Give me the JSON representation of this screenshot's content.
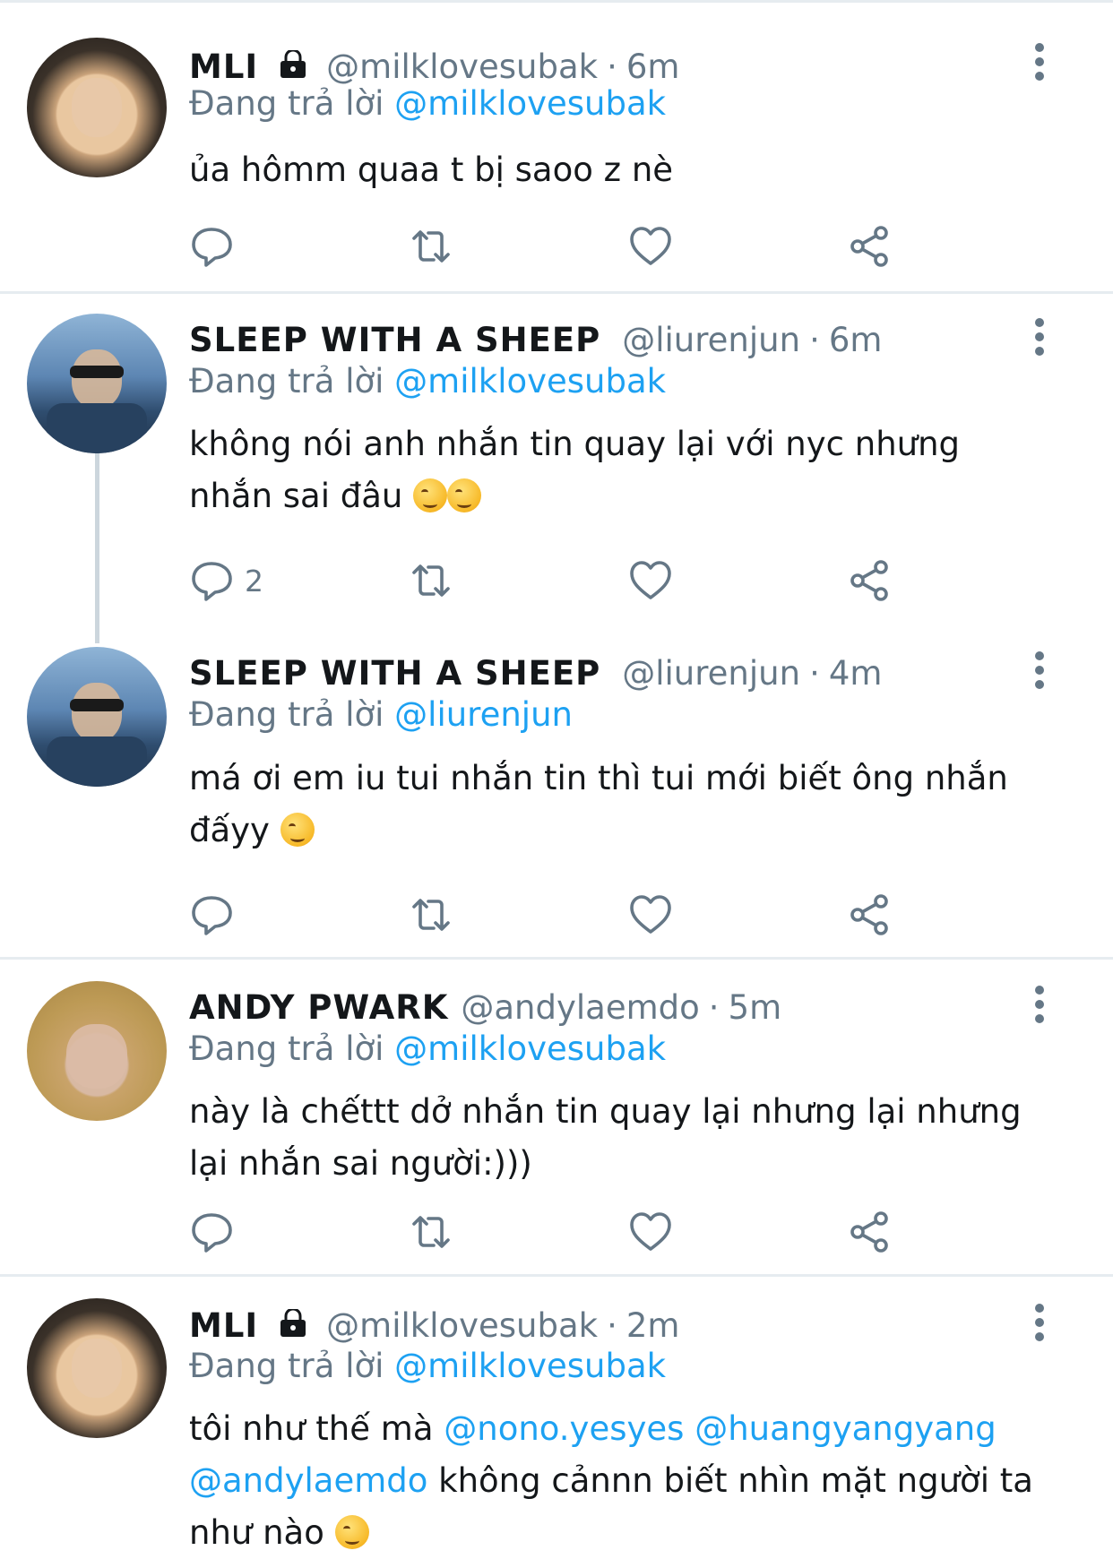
{
  "tweets": [
    {
      "name": "MLI",
      "protected": true,
      "handle": "@milklovesubak",
      "time": "6m",
      "reply_prefix": "Đang trả lời",
      "reply_to": "@milklovesubak",
      "text": "ủa hômm quaa t bị saoo z nè",
      "reply_count": ""
    },
    {
      "name": "SLEEP WITH A SHEEP",
      "protected": false,
      "handle": "@liurenjun",
      "time": "6m",
      "reply_prefix": "Đang trả lời",
      "reply_to": "@milklovesubak",
      "text": "không nói anh nhắn tin quay lại với nyc nhưng nhắn sai đâu",
      "reply_count": "2"
    },
    {
      "name": "SLEEP WITH A SHEEP",
      "protected": false,
      "handle": "@liurenjun",
      "time": "4m",
      "reply_prefix": "Đang trả lời",
      "reply_to": "@liurenjun",
      "text_line1": "má ơi em iu tui nhắn tin thì tui mới biết ông nhắn",
      "text_line2": "đấyy",
      "reply_count": ""
    },
    {
      "name": "ANDY PWARK",
      "protected": false,
      "handle": "@andylaemdo",
      "time": "5m",
      "reply_prefix": "Đang trả lời",
      "reply_to": "@milklovesubak",
      "text_line1": "này là chếttt dở nhắn tin quay lại nhưng lại nhưng",
      "text_line2": "lại nhắn sai người:)))",
      "reply_count": ""
    },
    {
      "name": "MLI",
      "protected": true,
      "handle": "@milklovesubak",
      "time": "2m",
      "reply_prefix": "Đang trả lời",
      "reply_to": "@milklovesubak",
      "text_part1": "tôi như thế mà",
      "mention1": "@nono.yesyes",
      "mention2": "@huangyangyang",
      "mention3": "@andylaemdo",
      "text_part2": "không cảnnn biết nhìn mặt người ta",
      "text_part3": "như nào",
      "reply_count": ""
    }
  ],
  "separator": "·",
  "icons": {
    "reply": "reply-icon",
    "retweet": "retweet-icon",
    "like": "heart-icon",
    "share": "share-icon",
    "more": "more-icon",
    "lock": "lock-icon"
  },
  "colors": {
    "mention": "#1da1f2",
    "muted": "#657786",
    "text": "#14171a",
    "divider": "#e6ecf0"
  }
}
